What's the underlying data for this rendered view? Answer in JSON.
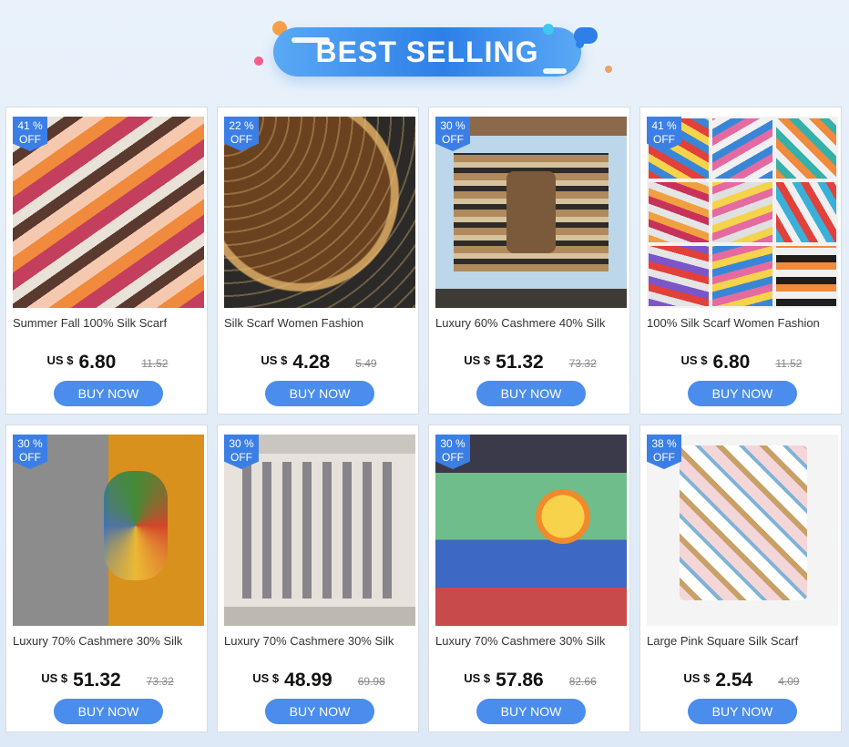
{
  "banner": {
    "title": "BEST SELLING"
  },
  "products": [
    {
      "discount_num": "41 %",
      "discount_word": "OFF",
      "title": "Summer Fall 100% Silk Scarf",
      "currency": "US $",
      "price": "6.80",
      "old_price": "11.52",
      "buy_label": "BUY NOW"
    },
    {
      "discount_num": "22 %",
      "discount_word": "OFF",
      "title": "Silk Scarf Women Fashion",
      "currency": "US $",
      "price": "4.28",
      "old_price": "5.49",
      "buy_label": "BUY NOW"
    },
    {
      "discount_num": "30 %",
      "discount_word": "OFF",
      "title": "Luxury 60% Cashmere 40% Silk",
      "currency": "US $",
      "price": "51.32",
      "old_price": "73.32",
      "buy_label": "BUY NOW"
    },
    {
      "discount_num": "41 %",
      "discount_word": "OFF",
      "title": "100% Silk Scarf Women Fashion",
      "currency": "US $",
      "price": "6.80",
      "old_price": "11.52",
      "buy_label": "BUY NOW"
    },
    {
      "discount_num": "30 %",
      "discount_word": "OFF",
      "title": "Luxury 70% Cashmere 30% Silk",
      "currency": "US $",
      "price": "51.32",
      "old_price": "73.32",
      "buy_label": "BUY NOW"
    },
    {
      "discount_num": "30 %",
      "discount_word": "OFF",
      "title": "Luxury 70% Cashmere 30% Silk",
      "currency": "US $",
      "price": "48.99",
      "old_price": "69.98",
      "buy_label": "BUY NOW"
    },
    {
      "discount_num": "30 %",
      "discount_word": "OFF",
      "title": "Luxury 70% Cashmere 30% Silk",
      "currency": "US $",
      "price": "57.86",
      "old_price": "82.66",
      "buy_label": "BUY NOW"
    },
    {
      "discount_num": "38 %",
      "discount_word": "OFF",
      "title": "Large Pink Square Silk Scarf",
      "currency": "US $",
      "price": "2.54",
      "old_price": "4.09",
      "buy_label": "BUY NOW"
    }
  ],
  "colors": {
    "accent": "#4b8dec",
    "badge": "#3b7fe6",
    "banner": "#2e7fe8"
  }
}
